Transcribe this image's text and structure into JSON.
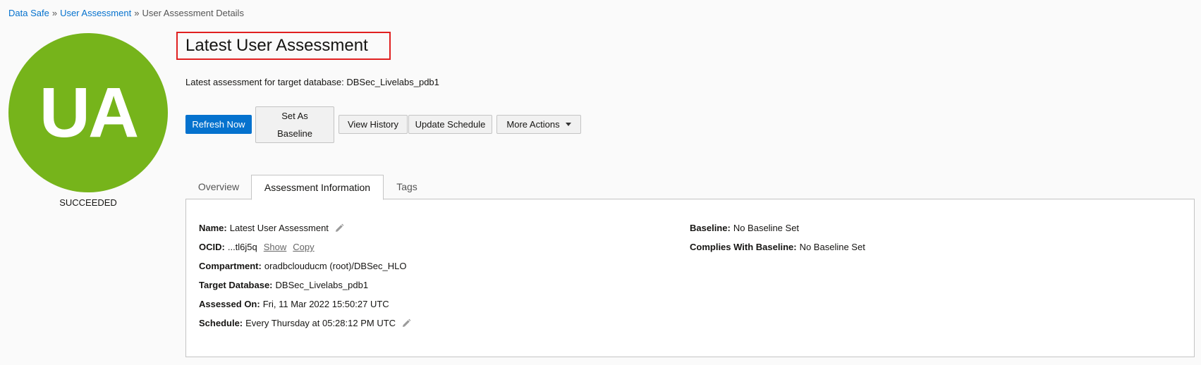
{
  "breadcrumb": {
    "items": [
      "Data Safe",
      "User Assessment"
    ],
    "current": "User Assessment Details",
    "separator": "»"
  },
  "avatar": {
    "initials": "UA",
    "color": "#76b41b",
    "status": "SUCCEEDED"
  },
  "header": {
    "title": "Latest User Assessment",
    "subtitle": "Latest assessment for target database: DBSec_Livelabs_pdb1"
  },
  "actions": {
    "refresh_now": "Refresh Now",
    "set_as_baseline_line1": "Set As",
    "set_as_baseline_line2": "Baseline",
    "view_history": "View History",
    "update_schedule": "Update Schedule",
    "more_actions": "More Actions"
  },
  "tabs": [
    {
      "label": "Overview",
      "active": false
    },
    {
      "label": "Assessment Information",
      "active": true
    },
    {
      "label": "Tags",
      "active": false
    }
  ],
  "info": {
    "left": {
      "name": {
        "label": "Name:",
        "value": "Latest User Assessment"
      },
      "ocid": {
        "label": "OCID:",
        "value": "...tl6j5q",
        "show": "Show",
        "copy": "Copy"
      },
      "compartment": {
        "label": "Compartment:",
        "value": "oradbclouducm (root)/DBSec_HLO"
      },
      "target_database": {
        "label": "Target Database:",
        "value": "DBSec_Livelabs_pdb1"
      },
      "assessed_on": {
        "label": "Assessed On:",
        "value": "Fri, 11 Mar 2022 15:50:27 UTC"
      },
      "schedule": {
        "label": "Schedule:",
        "value": "Every Thursday at 05:28:12 PM UTC"
      }
    },
    "right": {
      "baseline": {
        "label": "Baseline:",
        "value": "No Baseline Set"
      },
      "complies_with_baseline": {
        "label": "Complies With Baseline:",
        "value": "No Baseline Set"
      }
    }
  },
  "colors": {
    "primary": "#0572ce",
    "highlight": "#e02020",
    "success": "#76b41b"
  }
}
